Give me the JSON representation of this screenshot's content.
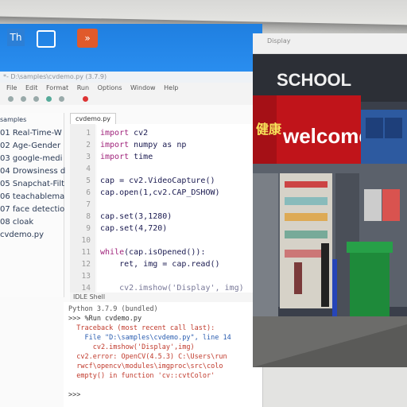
{
  "desktop": {
    "icons": [
      {
        "name": "app-icon-1",
        "label": "",
        "color": "#2c7fd6"
      },
      {
        "name": "app-icon-2",
        "label": "",
        "color": "#ffffff"
      },
      {
        "name": "app-icon-3",
        "label": "",
        "color": "#e05a2b"
      }
    ]
  },
  "ide": {
    "title": "*- D:\\samples\\cvdemo.py (3.7.9)",
    "menu": [
      "File",
      "Edit",
      "Format",
      "Run",
      "Options",
      "Window",
      "Help"
    ],
    "sidebar": {
      "heading": "samples",
      "items": [
        "01 Real-Time-W",
        "02 Age-Gender",
        "03 google-medi",
        "04 Drowsiness d",
        "05 Snapchat-Filt",
        "06 teachablema",
        "07 face detectio",
        "08 cloak",
        "cvdemo.py"
      ]
    },
    "tab": "cvdemo.py",
    "line_numbers": [
      "1",
      "2",
      "3",
      "4",
      "5",
      "6",
      "7",
      "8",
      "9",
      "10",
      "11",
      "12",
      "13",
      "14"
    ],
    "code": [
      {
        "k": "import",
        "t": " cv2"
      },
      {
        "k": "import",
        "t": " numpy as np"
      },
      {
        "k": "import",
        "t": " time"
      },
      {
        "k": "",
        "t": ""
      },
      {
        "k": "",
        "t": "cap = cv2.VideoCapture()"
      },
      {
        "k": "",
        "t": "cap.open(1,cv2.CAP_DSHOW)"
      },
      {
        "k": "",
        "t": ""
      },
      {
        "k": "",
        "t": "cap.set(3,1280)"
      },
      {
        "k": "",
        "t": "cap.set(4,720)"
      },
      {
        "k": "",
        "t": ""
      },
      {
        "k": "while",
        "t": "(cap.isOpened()):"
      },
      {
        "k": "",
        "t": "    ret, img = cap.read()"
      },
      {
        "k": "",
        "t": ""
      },
      {
        "k": "",
        "t": "    cv2.imshow('Display', img)"
      }
    ],
    "shell": {
      "title": "IDLE Shell",
      "lines": [
        {
          "t": "Python 3.7.9 (bundled)",
          "c": "#555555"
        },
        {
          "t": ">>> %Run cvdemo.py",
          "c": "#333333"
        },
        {
          "t": "  Traceback (most recent call last):",
          "c": "#c0392b"
        },
        {
          "t": "    File \"D:\\samples\\cvdemo.py\", line 14",
          "c": "#2a5db0"
        },
        {
          "t": "      cv2.imshow('Display',img)",
          "c": "#c0392b"
        },
        {
          "t": "  cv2.error: OpenCV(4.5.3) C:\\Users\\run",
          "c": "#c0392b"
        },
        {
          "t": "  rwcf\\opencv\\modules\\imgproc\\src\\colo",
          "c": "#c0392b"
        },
        {
          "t": "  empty() in function 'cv::cvtColor'",
          "c": "#c0392b"
        },
        {
          "t": "",
          "c": "#333333"
        },
        {
          "t": ">>>",
          "c": "#333333"
        }
      ]
    }
  },
  "display_window": {
    "title": "Display",
    "sign_school": "SCHOOL",
    "sign_welcome": "welcome",
    "sign_cjk": "健康",
    "colors": {
      "sign_red": "#c0141a",
      "mailbox_green": "#1e8a3a"
    }
  }
}
